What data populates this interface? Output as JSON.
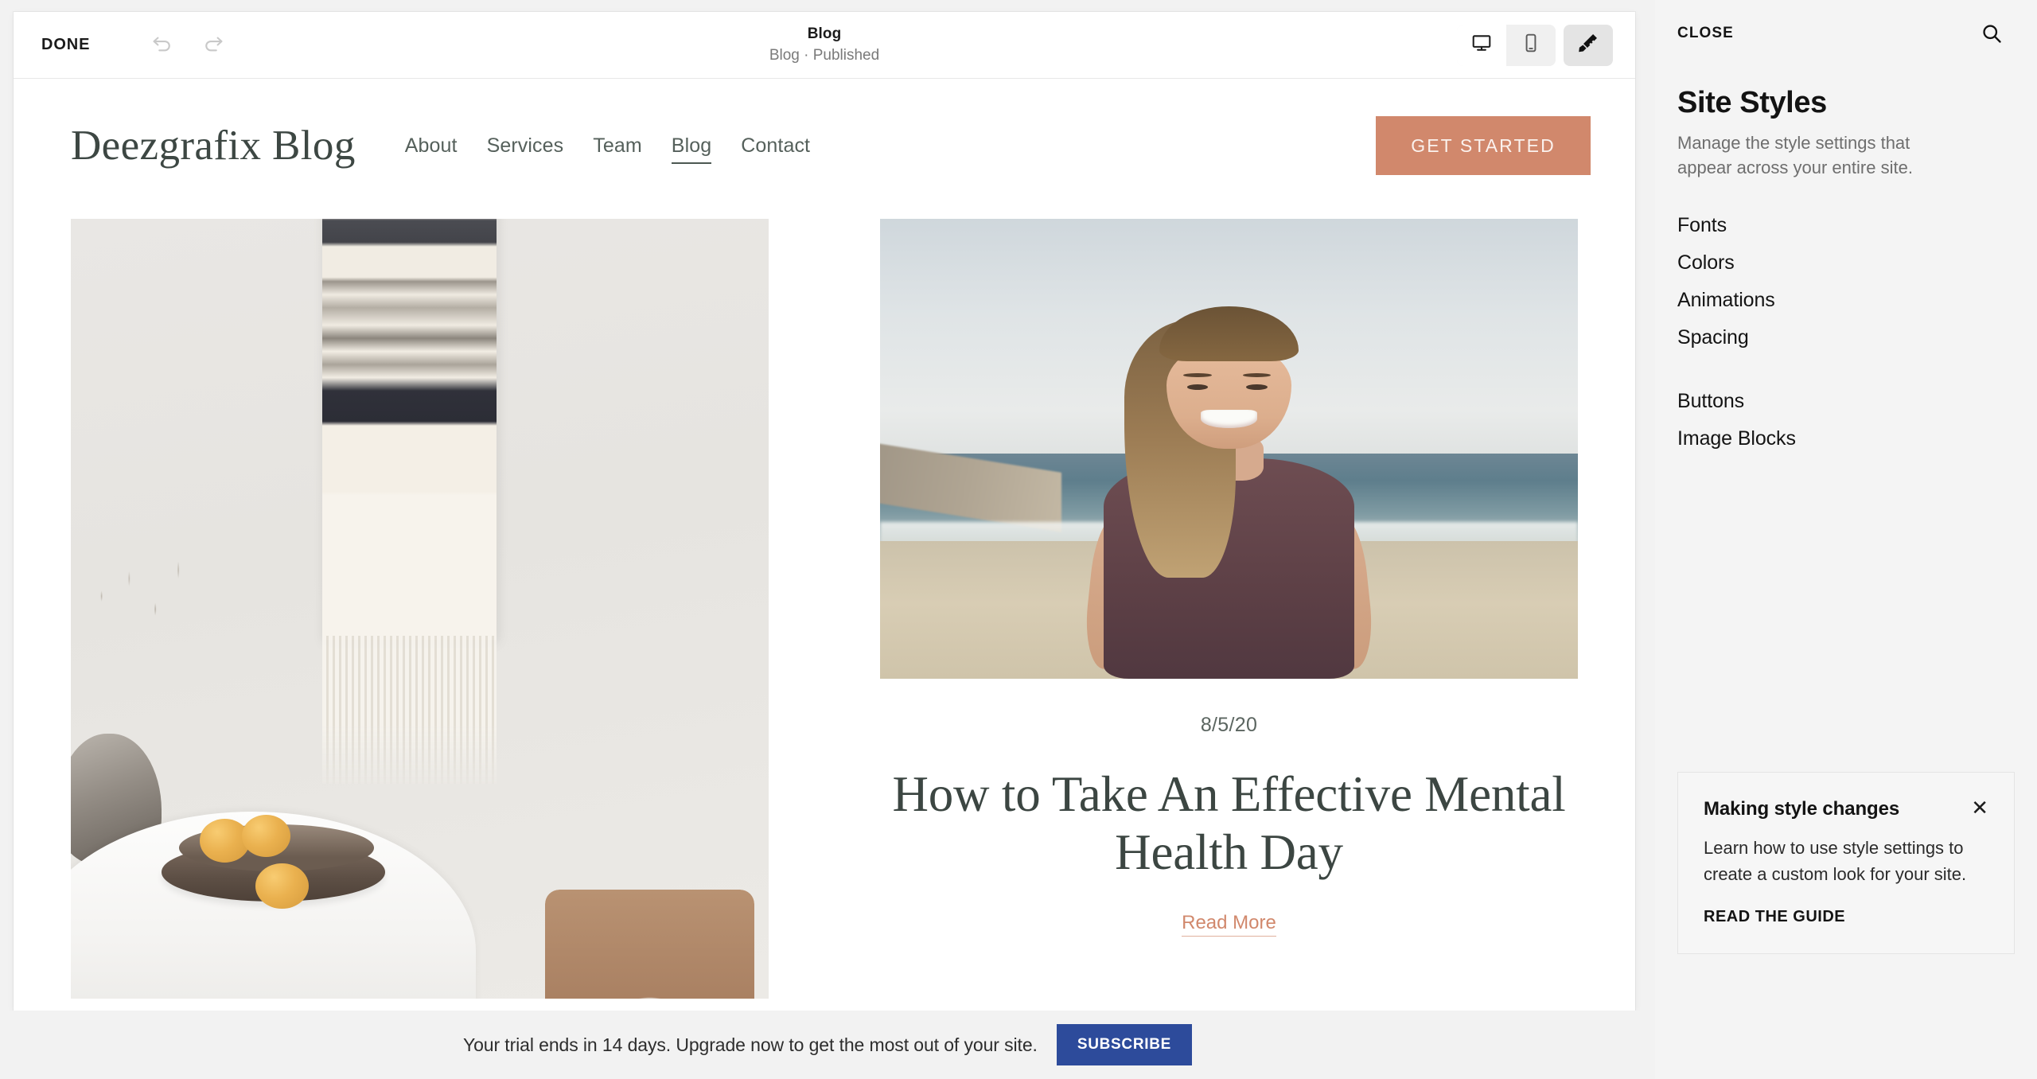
{
  "editor": {
    "toolbar": {
      "done_label": "DONE",
      "undo_icon": "undo-arrow-icon",
      "redo_icon": "redo-arrow-icon",
      "page_title": "Blog",
      "page_status": "Blog · Published",
      "device_desktop_icon": "desktop-monitor-icon",
      "device_mobile_icon": "mobile-phone-icon",
      "style_brush_icon": "paintbrush-icon",
      "active_device": "desktop",
      "style_brush_active": true
    }
  },
  "site": {
    "logo": "Deezgrafix Blog",
    "nav": [
      {
        "label": "About",
        "active": false
      },
      {
        "label": "Services",
        "active": false
      },
      {
        "label": "Team",
        "active": false
      },
      {
        "label": "Blog",
        "active": true
      },
      {
        "label": "Contact",
        "active": false
      }
    ],
    "cta_button": "GET STARTED",
    "posts": [
      {
        "image_alt": "minimalist-dining-room-with-woven-wall-hanging",
        "date": "",
        "title": "",
        "read_more": ""
      },
      {
        "image_alt": "smiling-woman-with-long-hair-on-beach",
        "date": "8/5/20",
        "title": "How to Take An Effective Mental Health Day",
        "read_more": "Read More"
      }
    ]
  },
  "style_panel": {
    "close_label": "CLOSE",
    "search_icon": "search-icon",
    "heading": "Site Styles",
    "subheading": "Manage the style settings that appear across your entire site.",
    "menu_group_1": [
      {
        "label": "Fonts"
      },
      {
        "label": "Colors"
      },
      {
        "label": "Animations"
      },
      {
        "label": "Spacing"
      }
    ],
    "menu_group_2": [
      {
        "label": "Buttons"
      },
      {
        "label": "Image Blocks"
      }
    ],
    "tip": {
      "title": "Making style changes",
      "close_icon": "close-x-icon",
      "body": "Learn how to use style settings to create a custom look for your site.",
      "link": "READ THE GUIDE"
    }
  },
  "trial_bar": {
    "message": "Your trial ends in 14 days. Upgrade now to get the most out of your site.",
    "subscribe_label": "SUBSCRIBE"
  },
  "colors": {
    "accent_terracotta": "#d1886c",
    "subscribe_blue": "#2d4b9b",
    "panel_bg": "#f4f4f4",
    "app_bg": "#f2f2f2",
    "site_text_dark": "#3c4642"
  }
}
